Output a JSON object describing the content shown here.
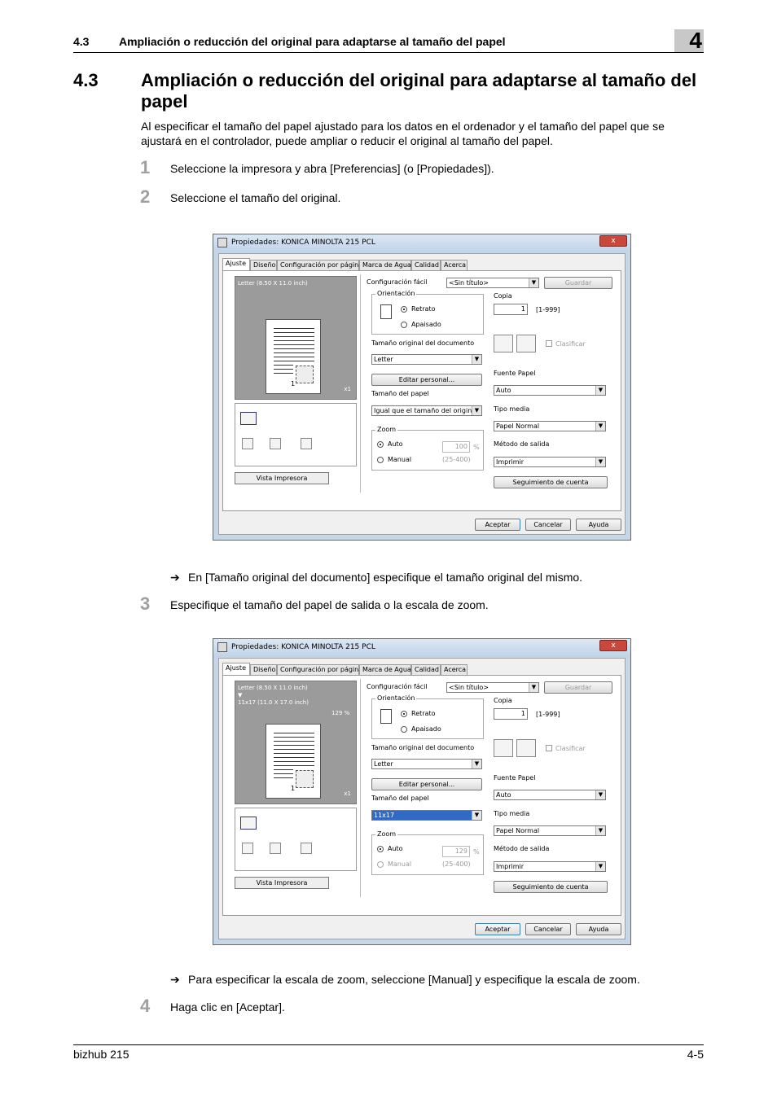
{
  "header": {
    "section_number": "4.3",
    "section_title": "Ampliación o reducción del original para adaptarse al tamaño del papel",
    "chapter": "4"
  },
  "heading": {
    "number": "4.3",
    "title": "Ampliación o reducción del original para adaptarse al tamaño del papel"
  },
  "intro": "Al especificar el tamaño del papel ajustado para los datos en el ordenador y el tamaño del papel que se ajustará en el controlador, puede ampliar o reducir el original al tamaño del papel.",
  "steps": [
    {
      "num": "1",
      "text": "Seleccione la impresora y abra [Preferencias] (o [Propiedades])."
    },
    {
      "num": "2",
      "text": "Seleccione el tamaño del original."
    },
    {
      "num": "3",
      "text": "Especifique el tamaño del papel de salida o la escala de zoom."
    },
    {
      "num": "4",
      "text": "Haga clic en [Aceptar]."
    }
  ],
  "notes": [
    {
      "arrow": "➔",
      "text": "En [Tamaño original del documento] especifique el tamaño original del mismo."
    },
    {
      "arrow": "➔",
      "text": "Para especificar la escala de zoom, seleccione [Manual] y especifique la escala de zoom."
    }
  ],
  "dialog_common": {
    "title": "Propiedades: KONICA MINOLTA 215 PCL",
    "close": "x",
    "tabs": [
      "Ajuste",
      "Diseño",
      "Configuración por página",
      "Marca de Agua",
      "Calidad",
      "Acerca"
    ],
    "easy_setting_label": "Configuración fácil",
    "easy_setting_value": "<Sin título>",
    "save": "Guardar",
    "orientation_label": "Orientación",
    "portrait": "Retrato",
    "landscape": "Apaisado",
    "copies_label": "Copia",
    "copies_value": "1",
    "copies_range": "[1-999]",
    "collate": "Clasificar",
    "orig_size_label": "Tamaño original del documento",
    "orig_size_value": "Letter",
    "custom_button": "Editar personal...",
    "paper_size_label": "Tamaño del papel",
    "paper_source_label": "Fuente Papel",
    "paper_source_value": "Auto",
    "media_label": "Tipo media",
    "media_value": "Papel Normal",
    "zoom_label": "Zoom",
    "zoom_auto": "Auto",
    "zoom_manual": "Manual",
    "zoom_pct": "%",
    "zoom_range": "(25-400)",
    "output_label": "Método de salida",
    "output_value": "Imprimir",
    "account_button": "Seguimiento de cuenta",
    "view_button": "Vista Impresora",
    "preview_x1": "x1",
    "page_mark": "1",
    "ok": "Aceptar",
    "cancel": "Cancelar",
    "help": "Ayuda"
  },
  "dialog1": {
    "preview_line1": "Letter (8.50 X 11.0 inch)",
    "paper_size_value": "Igual que el tamaño del original",
    "zoom_value": "100"
  },
  "dialog2": {
    "preview_line1": "Letter (8.50 X 11.0 inch)",
    "preview_arrow": "▼",
    "preview_line2": "11x17 (11.0 X 17.0 inch)",
    "preview_pct": "129 %",
    "paper_size_value": "11x17",
    "zoom_value": "129"
  },
  "footer": {
    "left": "bizhub 215",
    "right": "4-5"
  }
}
